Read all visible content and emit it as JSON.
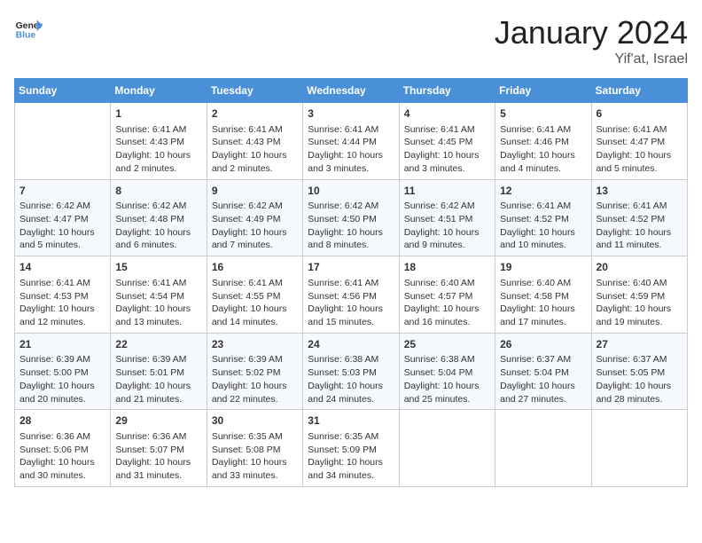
{
  "header": {
    "logo_line1": "General",
    "logo_line2": "Blue",
    "month_title": "January 2024",
    "location": "Yif'at, Israel"
  },
  "days_of_week": [
    "Sunday",
    "Monday",
    "Tuesday",
    "Wednesday",
    "Thursday",
    "Friday",
    "Saturday"
  ],
  "weeks": [
    [
      {
        "day": "",
        "info": ""
      },
      {
        "day": "1",
        "info": "Sunrise: 6:41 AM\nSunset: 4:43 PM\nDaylight: 10 hours\nand 2 minutes."
      },
      {
        "day": "2",
        "info": "Sunrise: 6:41 AM\nSunset: 4:43 PM\nDaylight: 10 hours\nand 2 minutes."
      },
      {
        "day": "3",
        "info": "Sunrise: 6:41 AM\nSunset: 4:44 PM\nDaylight: 10 hours\nand 3 minutes."
      },
      {
        "day": "4",
        "info": "Sunrise: 6:41 AM\nSunset: 4:45 PM\nDaylight: 10 hours\nand 3 minutes."
      },
      {
        "day": "5",
        "info": "Sunrise: 6:41 AM\nSunset: 4:46 PM\nDaylight: 10 hours\nand 4 minutes."
      },
      {
        "day": "6",
        "info": "Sunrise: 6:41 AM\nSunset: 4:47 PM\nDaylight: 10 hours\nand 5 minutes."
      }
    ],
    [
      {
        "day": "7",
        "info": "Sunrise: 6:42 AM\nSunset: 4:47 PM\nDaylight: 10 hours\nand 5 minutes."
      },
      {
        "day": "8",
        "info": "Sunrise: 6:42 AM\nSunset: 4:48 PM\nDaylight: 10 hours\nand 6 minutes."
      },
      {
        "day": "9",
        "info": "Sunrise: 6:42 AM\nSunset: 4:49 PM\nDaylight: 10 hours\nand 7 minutes."
      },
      {
        "day": "10",
        "info": "Sunrise: 6:42 AM\nSunset: 4:50 PM\nDaylight: 10 hours\nand 8 minutes."
      },
      {
        "day": "11",
        "info": "Sunrise: 6:42 AM\nSunset: 4:51 PM\nDaylight: 10 hours\nand 9 minutes."
      },
      {
        "day": "12",
        "info": "Sunrise: 6:41 AM\nSunset: 4:52 PM\nDaylight: 10 hours\nand 10 minutes."
      },
      {
        "day": "13",
        "info": "Sunrise: 6:41 AM\nSunset: 4:52 PM\nDaylight: 10 hours\nand 11 minutes."
      }
    ],
    [
      {
        "day": "14",
        "info": "Sunrise: 6:41 AM\nSunset: 4:53 PM\nDaylight: 10 hours\nand 12 minutes."
      },
      {
        "day": "15",
        "info": "Sunrise: 6:41 AM\nSunset: 4:54 PM\nDaylight: 10 hours\nand 13 minutes."
      },
      {
        "day": "16",
        "info": "Sunrise: 6:41 AM\nSunset: 4:55 PM\nDaylight: 10 hours\nand 14 minutes."
      },
      {
        "day": "17",
        "info": "Sunrise: 6:41 AM\nSunset: 4:56 PM\nDaylight: 10 hours\nand 15 minutes."
      },
      {
        "day": "18",
        "info": "Sunrise: 6:40 AM\nSunset: 4:57 PM\nDaylight: 10 hours\nand 16 minutes."
      },
      {
        "day": "19",
        "info": "Sunrise: 6:40 AM\nSunset: 4:58 PM\nDaylight: 10 hours\nand 17 minutes."
      },
      {
        "day": "20",
        "info": "Sunrise: 6:40 AM\nSunset: 4:59 PM\nDaylight: 10 hours\nand 19 minutes."
      }
    ],
    [
      {
        "day": "21",
        "info": "Sunrise: 6:39 AM\nSunset: 5:00 PM\nDaylight: 10 hours\nand 20 minutes."
      },
      {
        "day": "22",
        "info": "Sunrise: 6:39 AM\nSunset: 5:01 PM\nDaylight: 10 hours\nand 21 minutes."
      },
      {
        "day": "23",
        "info": "Sunrise: 6:39 AM\nSunset: 5:02 PM\nDaylight: 10 hours\nand 22 minutes."
      },
      {
        "day": "24",
        "info": "Sunrise: 6:38 AM\nSunset: 5:03 PM\nDaylight: 10 hours\nand 24 minutes."
      },
      {
        "day": "25",
        "info": "Sunrise: 6:38 AM\nSunset: 5:04 PM\nDaylight: 10 hours\nand 25 minutes."
      },
      {
        "day": "26",
        "info": "Sunrise: 6:37 AM\nSunset: 5:04 PM\nDaylight: 10 hours\nand 27 minutes."
      },
      {
        "day": "27",
        "info": "Sunrise: 6:37 AM\nSunset: 5:05 PM\nDaylight: 10 hours\nand 28 minutes."
      }
    ],
    [
      {
        "day": "28",
        "info": "Sunrise: 6:36 AM\nSunset: 5:06 PM\nDaylight: 10 hours\nand 30 minutes."
      },
      {
        "day": "29",
        "info": "Sunrise: 6:36 AM\nSunset: 5:07 PM\nDaylight: 10 hours\nand 31 minutes."
      },
      {
        "day": "30",
        "info": "Sunrise: 6:35 AM\nSunset: 5:08 PM\nDaylight: 10 hours\nand 33 minutes."
      },
      {
        "day": "31",
        "info": "Sunrise: 6:35 AM\nSunset: 5:09 PM\nDaylight: 10 hours\nand 34 minutes."
      },
      {
        "day": "",
        "info": ""
      },
      {
        "day": "",
        "info": ""
      },
      {
        "day": "",
        "info": ""
      }
    ]
  ]
}
